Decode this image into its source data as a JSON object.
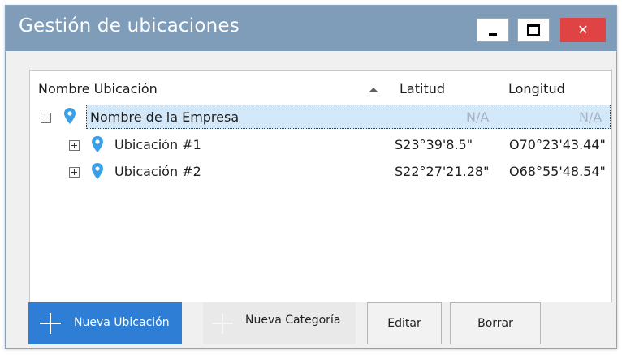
{
  "window": {
    "title": "Gestión de ubicaciones",
    "controls": {
      "minimize": "minimize",
      "maximize": "maximize",
      "close": "✕"
    }
  },
  "table": {
    "columns": {
      "name": "Nombre Ubicación",
      "lat": "Latitud",
      "lon": "Longitud"
    },
    "sort": "ascending",
    "rows": [
      {
        "name": "Nombre de la Empresa",
        "lat": "N/A",
        "lon": "N/A",
        "expanded": true,
        "selected": true,
        "icon": "map-pin-icon"
      },
      {
        "name": "Ubicación #1",
        "lat": "S23°39'8.5\"",
        "lon": "O70°23'43.44\"",
        "expanded": false,
        "icon": "map-pin-icon"
      },
      {
        "name": "Ubicación #2",
        "lat": "S22°27'21.28\"",
        "lon": "O68°55'48.54\"",
        "expanded": false,
        "icon": "map-pin-icon"
      }
    ]
  },
  "buttons": {
    "new_location": "Nueva Ubicación",
    "new_category": "Nueva Categoría",
    "edit": "Editar",
    "delete": "Borrar"
  },
  "colors": {
    "titlebar": "#7f9cb8",
    "close": "#e04343",
    "primary": "#2e7ed6",
    "selected_row": "#d3e8f8",
    "pin": "#3aa0e6"
  }
}
